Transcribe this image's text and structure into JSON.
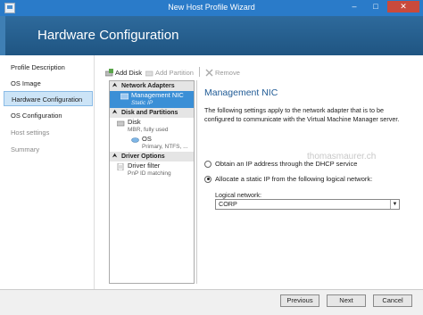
{
  "window": {
    "title": "New Host Profile Wizard"
  },
  "banner": {
    "heading": "Hardware Configuration"
  },
  "nav": {
    "items": [
      {
        "label": "Profile Description",
        "state": "normal"
      },
      {
        "label": "OS Image",
        "state": "normal"
      },
      {
        "label": "Hardware Configuration",
        "state": "active"
      },
      {
        "label": "OS Configuration",
        "state": "normal"
      },
      {
        "label": "Host settings",
        "state": "disabled"
      },
      {
        "label": "Summary",
        "state": "disabled"
      }
    ]
  },
  "toolbar": {
    "add_disk": "Add Disk",
    "add_partition": "Add Partition",
    "remove": "Remove"
  },
  "tree": {
    "network_header": "Network Adapters",
    "nic_name": "Management NIC",
    "nic_sub": "Static IP",
    "disk_header": "Disk and Partitions",
    "disk_name": "Disk",
    "disk_sub": "MBR, fully used",
    "os_name": "OS",
    "os_sub": "Primary, NTFS, ...",
    "driver_header": "Driver Options",
    "driver_name": "Driver filter",
    "driver_sub": "PnP ID matching"
  },
  "details": {
    "heading": "Management NIC",
    "description": "The following settings apply to the network adapter that is to be configured to communicate with the Virtual Machine Manager server.",
    "option_dhcp": "Obtain an IP address through the DHCP service",
    "option_static": "Allocate a static IP from the following logical network:",
    "logical_network_label": "Logical network:",
    "logical_network_value": "CORP"
  },
  "watermark": "thomasmaurer.ch",
  "footer": {
    "previous": "Previous",
    "next": "Next",
    "cancel": "Cancel"
  },
  "colors": {
    "accent": "#2a7bc9",
    "banner": "#2e6a9c",
    "selection": "#3b8fd6"
  }
}
